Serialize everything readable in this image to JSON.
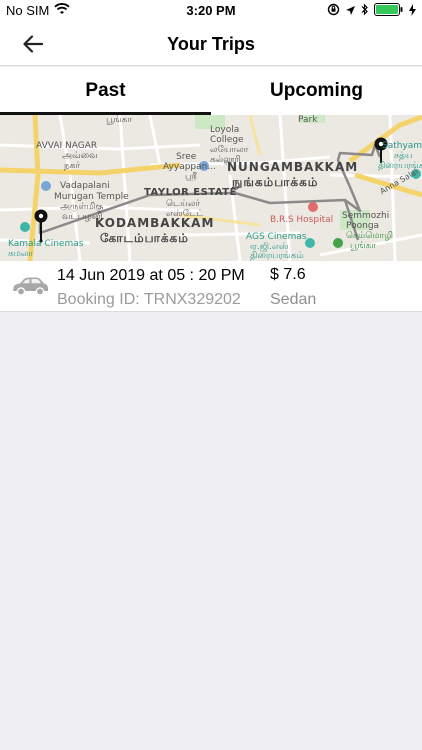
{
  "status_bar": {
    "carrier": "No SIM",
    "time": "3:20 PM"
  },
  "nav": {
    "title": "Your Trips"
  },
  "tabs": [
    {
      "label": "Past",
      "active": true
    },
    {
      "label": "Upcoming",
      "active": false
    }
  ],
  "trip": {
    "date_time": "14 Jun 2019 at 05 : 20 PM",
    "booking_id": "Booking ID: TRNX329202",
    "fare": "$ 7.6",
    "car_type": "Sedan"
  },
  "map": {
    "labels": {
      "l1": "AVVAI NAGAR",
      "l1t": "அவ்வை",
      "l1t2": "நகர்",
      "l2": "Loyola",
      "l2b": "College",
      "l2t": "லயோலா",
      "l2t2": "கல்லூரி",
      "l3": "Sree",
      "l3b": "Ayyappan...",
      "l3t": "ஸ்ரீ",
      "l3t2": "ஐயப்பன்...",
      "l4": "Vadapalani",
      "l4b": "Murugan Temple",
      "l4t": "அருள்மிகு",
      "l4t2": "வடபழனி",
      "l5": "TAYLOR ESTATE",
      "l5t": "டெய்லர்",
      "l5t2": "எஸ்டேட்",
      "l6": "NUNGAMBAKKAM",
      "l6t": "நுங்கம்பாக்கம்",
      "l7": "KODAMBAKKAM",
      "l7t": "கோடம்பாக்கம்",
      "l8": "B.R.S Hospital",
      "l9": "Semmozhi",
      "l9b": "Poonga",
      "l9t": "செம்மொழி",
      "l9t2": "பூங்கா",
      "l10": "AGS Cinemas",
      "l10t": "ஏ.ஜி.எஸ்",
      "l10t2": "திரையரங்கம்",
      "l11": "Kamala Cinemas",
      "l11t": "கமலா",
      "l11t2": "திரையரங்கம்",
      "l12": "Sathyam Cinem",
      "l12t": "சத்ய",
      "l12t2": "திரையரங்க",
      "l13": "Park",
      "l14": "Anna Salai",
      "l15": "பூங்கா"
    },
    "colors": {
      "route": "#8a8a8a",
      "pin": "#111111",
      "road_major": "#f5d36b",
      "park": "#cde8c5"
    }
  }
}
